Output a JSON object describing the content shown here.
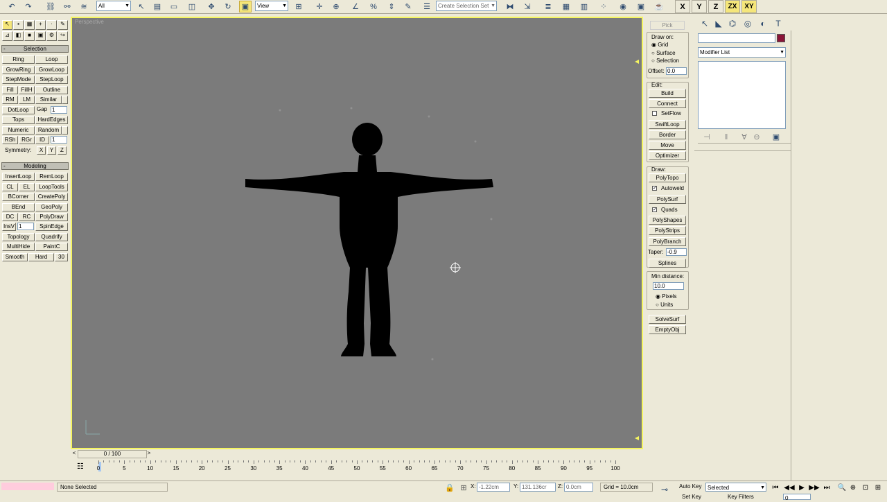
{
  "toolbar": {
    "selection_filter": "All",
    "reference_coord": "View",
    "named_selection_placeholder": "Create Selection Set",
    "axes": [
      "X",
      "Y",
      "Z",
      "ZX",
      "XY"
    ]
  },
  "left_panel": {
    "selection_header": "Selection",
    "selection_buttons": [
      [
        "Ring",
        "Loop"
      ],
      [
        "GrowRing",
        "GrowLoop"
      ],
      [
        "StepMode",
        "StepLoop"
      ],
      [
        "Fill",
        "FillH",
        "Outline"
      ],
      [
        "RM",
        "LM",
        "Similar"
      ],
      [
        "DotLoop",
        "Gap"
      ],
      [
        "Tops",
        "HardEdges"
      ],
      [
        "Numeric",
        "Random"
      ],
      [
        "RSh",
        "RGr",
        "ID"
      ]
    ],
    "gap_value": "1",
    "id_value": "1",
    "symmetry_label": "Symmetry:",
    "symmetry_axes": [
      "X",
      "Y",
      "Z"
    ],
    "modeling_header": "Modeling",
    "modeling_buttons": [
      [
        "InsertLoop",
        "RemLoop"
      ],
      [
        "CL",
        "EL",
        "LoopTools"
      ],
      [
        "BCorner",
        "CreatePoly"
      ],
      [
        "BEnd",
        "GeoPoly"
      ],
      [
        "DC",
        "RC",
        "PolyDraw"
      ],
      [
        "InsV",
        "SpinEdge"
      ],
      [
        "Topology",
        "Quadrify"
      ],
      [
        "MultiHide",
        "PaintC"
      ],
      [
        "Smooth",
        "Hard",
        "30"
      ]
    ],
    "insv_value": "1"
  },
  "viewport": {
    "label": "Perspective"
  },
  "draw_panel": {
    "pick_label": "Pick",
    "draw_on_label": "Draw on:",
    "draw_on_options": [
      "Grid",
      "Surface",
      "Selection"
    ],
    "offset_label": "Offset:",
    "offset_value": "0.0",
    "edit_label": "Edit:",
    "edit_buttons": [
      "Build",
      "Connect"
    ],
    "setflow_label": "SetFlow",
    "edit_buttons2": [
      "SwiftLoop",
      "Border",
      "Move",
      "Optimizer"
    ],
    "draw_label": "Draw:",
    "polytopo": "PolyTopo",
    "autoweld": "Autoweld",
    "polysurf": "PolySurf",
    "quads": "Quads",
    "draw_buttons": [
      "PolyShapes",
      "PolyStrips",
      "PolyBranch"
    ],
    "taper_label": "Taper:",
    "taper_value": "-0.9",
    "splines": "Splines",
    "min_distance_label": "Min distance:",
    "min_distance_value": "10.0",
    "units_options": [
      "Pixels",
      "Units"
    ],
    "solvesurf": "SolveSurf",
    "emptyobj": "EmptyObj"
  },
  "command_panel": {
    "modifier_list": "Modifier List",
    "color": "#8b1538"
  },
  "timeline": {
    "frame": "0 / 100",
    "ticks": [
      "0",
      "5",
      "10",
      "15",
      "20",
      "25",
      "30",
      "35",
      "40",
      "45",
      "50",
      "55",
      "60",
      "65",
      "70",
      "75",
      "80",
      "85",
      "90",
      "95",
      "100"
    ]
  },
  "status": {
    "selection": "None Selected",
    "x_label": "X:",
    "x_value": "-1.22cm",
    "y_label": "Y:",
    "y_value": "131.136cr",
    "z_label": "Z:",
    "z_value": "0.0cm",
    "grid": "Grid = 10.0cm",
    "auto_key": "Auto Key",
    "selected": "Selected",
    "set_key": "Set Key",
    "key_filters": "Key Filters",
    "frame_field": "0"
  }
}
